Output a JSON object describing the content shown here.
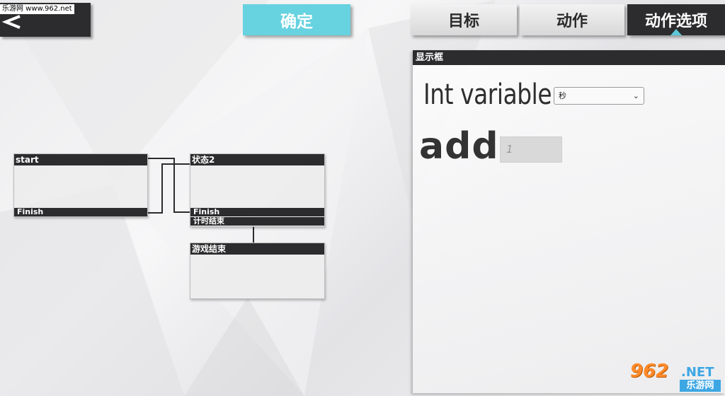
{
  "watermark": {
    "top_text": "乐游网 www.962.net",
    "logo_main": "962",
    "logo_net": ".NET",
    "logo_cn": "乐游网"
  },
  "toolbar": {
    "back_icon": "back-arrow-icon",
    "confirm_label": "确定"
  },
  "tabs": [
    {
      "label": "目标",
      "active": false
    },
    {
      "label": "动作",
      "active": false
    },
    {
      "label": "动作选项",
      "active": true
    }
  ],
  "panel": {
    "title": "显示框",
    "variable_label": "Int variable",
    "variable_select_value": "秒",
    "add_label": "add",
    "add_input_placeholder": "1"
  },
  "nodes": {
    "start": {
      "title": "start",
      "event": "Finish"
    },
    "state2": {
      "title": "状态2",
      "events": [
        "Finish",
        "计时结束"
      ]
    },
    "game_over": {
      "title": "游戏结束"
    }
  },
  "colors": {
    "accent": "#67d2e0",
    "dark": "#2c2c2e"
  }
}
